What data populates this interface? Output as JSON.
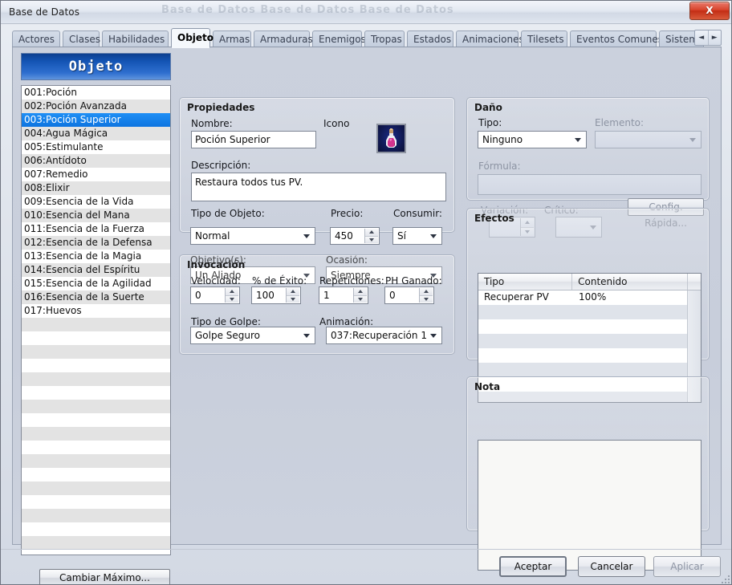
{
  "window": {
    "title": "Base de Datos",
    "ghost_text": "Base de Datos  Base de Datos  Base de Datos",
    "close_label": "X"
  },
  "tabs": {
    "items": [
      {
        "label": "Actores",
        "active": false
      },
      {
        "label": "Clases",
        "active": false
      },
      {
        "label": "Habilidades",
        "active": false
      },
      {
        "label": "Objeto",
        "active": true
      },
      {
        "label": "Armas",
        "active": false
      },
      {
        "label": "Armaduras",
        "active": false
      },
      {
        "label": "Enemigos",
        "active": false
      },
      {
        "label": "Tropas",
        "active": false
      },
      {
        "label": "Estados",
        "active": false
      },
      {
        "label": "Animaciones",
        "active": false
      },
      {
        "label": "Tilesets",
        "active": false
      },
      {
        "label": "Eventos Comunes",
        "active": false
      },
      {
        "label": "Sistema",
        "active": false
      }
    ],
    "nav_prev": "◄",
    "nav_next": "►"
  },
  "sidebar": {
    "header": "Objeto",
    "items": [
      "001:Poción",
      "002:Poción Avanzada",
      "003:Poción Superior",
      "004:Agua Mágica",
      "005:Estimulante",
      "006:Antídoto",
      "007:Remedio",
      "008:Elixir",
      "009:Esencia de la Vida",
      "010:Esencia del Mana",
      "011:Esencia de la Fuerza",
      "012:Esencia de la Defensa",
      "013:Esencia de la Magia",
      "014:Esencia del Espíritu",
      "015:Esencia de la Agilidad",
      "016:Esencia de la Suerte",
      "017:Huevos"
    ],
    "selected_index": 2,
    "empty_rows": 18,
    "change_max_button": "Cambiar Máximo..."
  },
  "properties": {
    "title": "Propiedades",
    "name_label": "Nombre:",
    "name_value": "Poción Superior",
    "icon_label": "Icono",
    "description_label": "Descripción:",
    "description_value": "Restaura todos tus PV.",
    "item_type_label": "Tipo de Objeto:",
    "item_type_value": "Normal",
    "price_label": "Precio:",
    "price_value": "450",
    "consume_label": "Consumir:",
    "consume_value": "Sí",
    "target_label": "Objetivo(s):",
    "target_value": "Un Aliado",
    "occasion_label": "Ocasión:",
    "occasion_value": "Siempre"
  },
  "invocation": {
    "title": "Invocación",
    "speed_label": "Velocidad:",
    "speed_value": "0",
    "success_label": "% de Éxito:",
    "success_value": "100",
    "repeats_label": "Repeticiones:",
    "repeats_value": "1",
    "tp_gain_label": "PH Ganado:",
    "tp_gain_value": "0",
    "hit_type_label": "Tipo de Golpe:",
    "hit_type_value": "Golpe Seguro",
    "animation_label": "Animación:",
    "animation_value": "037:Recuperación 1"
  },
  "damage": {
    "title": "Daño",
    "type_label": "Tipo:",
    "type_value": "Ninguno",
    "element_label": "Elemento:",
    "element_value": "",
    "formula_label": "Fórmula:",
    "formula_value": "",
    "variance_label": "Variación:",
    "variance_value": "",
    "critical_label": "Crítico:",
    "critical_value": "",
    "quick_config_button": "Config. Rápida..."
  },
  "effects": {
    "title": "Efectos",
    "columns": [
      "Tipo",
      "Contenido"
    ],
    "rows": [
      {
        "type": "Recuperar PV",
        "content": "100%"
      }
    ],
    "empty_rows": 7
  },
  "note": {
    "title": "Nota",
    "value": ""
  },
  "footer": {
    "ok": "Aceptar",
    "cancel": "Cancelar",
    "apply": "Aplicar"
  },
  "colors": {
    "accent_blue": "#1455b5",
    "selection_blue": "#0e74e0",
    "close_red": "#c32d15",
    "panel_bg": "#c8cedb",
    "field_white": "#ffffff"
  }
}
